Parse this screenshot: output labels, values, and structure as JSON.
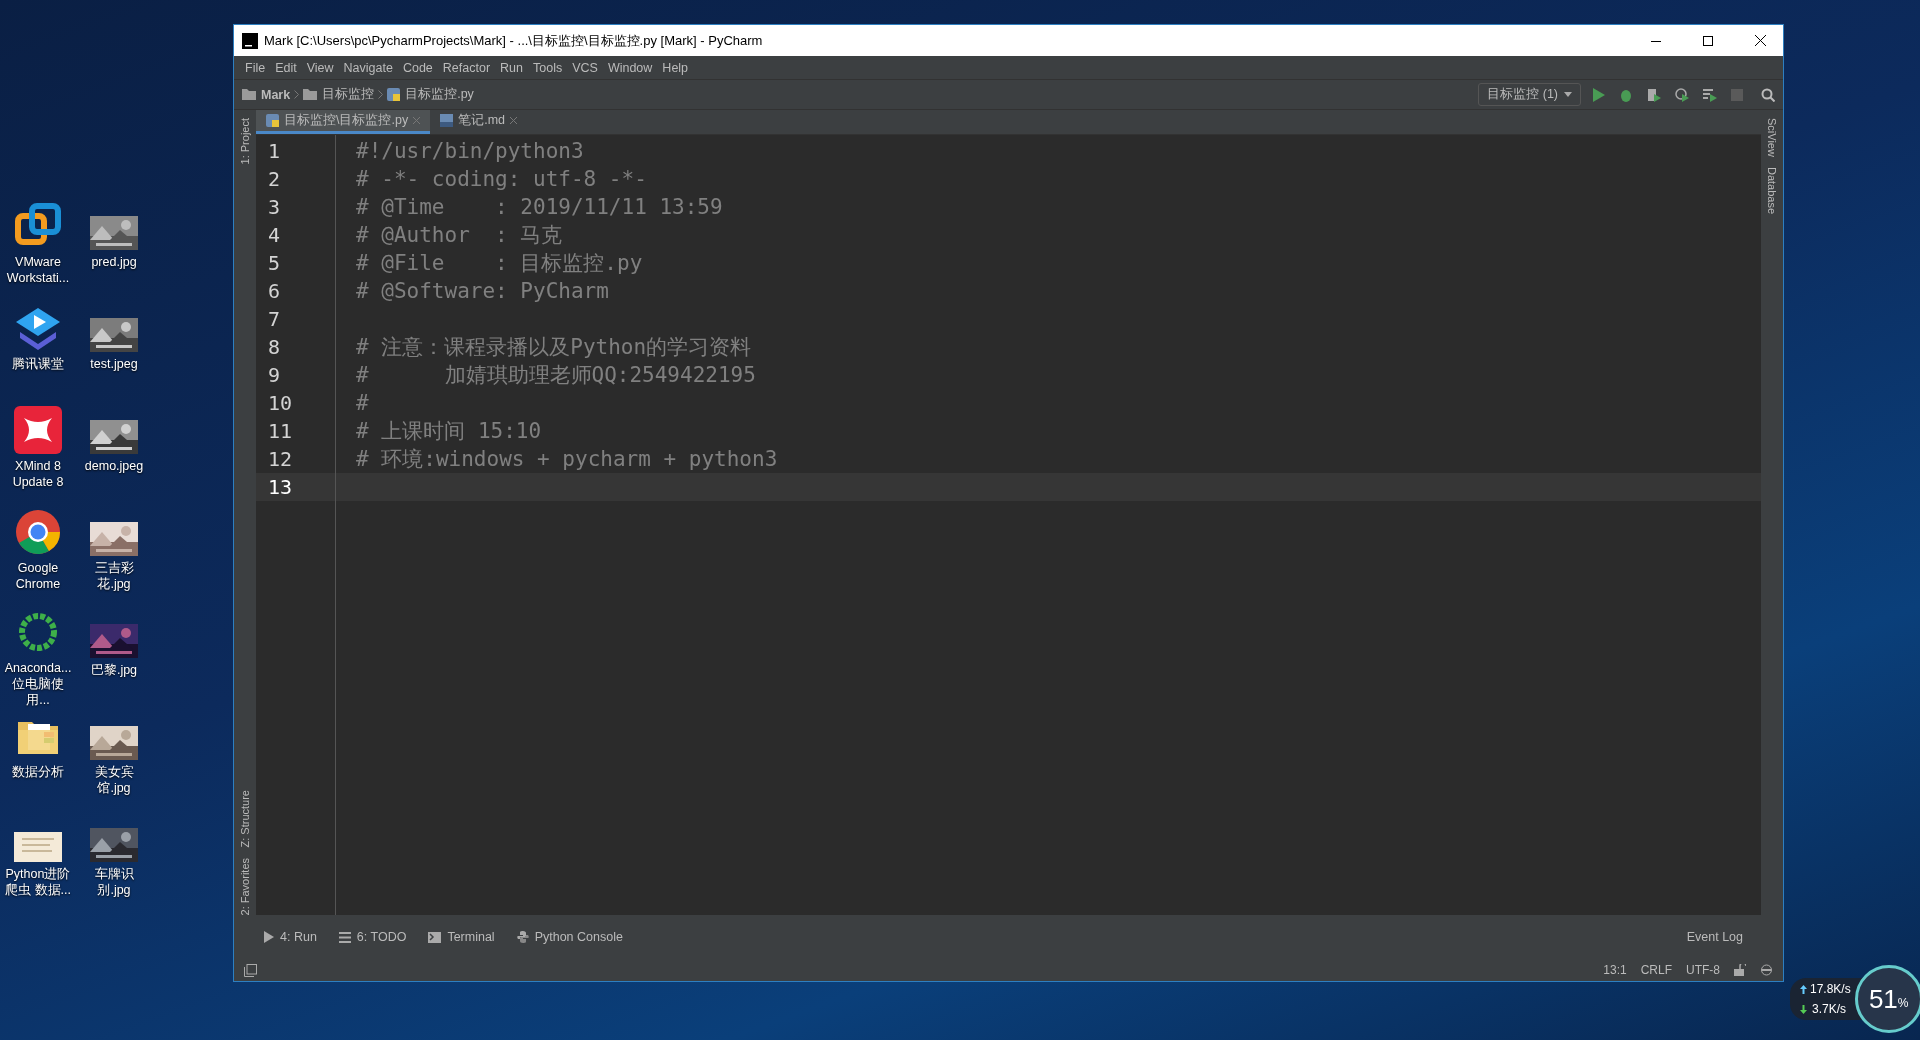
{
  "desktop": {
    "icons": [
      {
        "label": "VMware Workstati...",
        "kind": "vmware"
      },
      {
        "label": "pred.jpg",
        "kind": "picture"
      },
      {
        "label": "腾讯课堂",
        "kind": "tencent"
      },
      {
        "label": "test.jpeg",
        "kind": "picture"
      },
      {
        "label": "XMind 8 Update 8",
        "kind": "xmind"
      },
      {
        "label": "demo.jpeg",
        "kind": "picture"
      },
      {
        "label": "Google Chrome",
        "kind": "chrome"
      },
      {
        "label": "三吉彩花.jpg",
        "kind": "picture"
      },
      {
        "label": "Anaconda... 位电脑使用...",
        "kind": "anaconda"
      },
      {
        "label": "巴黎.jpg",
        "kind": "picture"
      },
      {
        "label": "数据分析",
        "kind": "folder"
      },
      {
        "label": "美女宾馆.jpg",
        "kind": "picture"
      },
      {
        "label": "Python进阶爬虫 数据...",
        "kind": "document"
      },
      {
        "label": "车牌识别.jpg",
        "kind": "picture"
      }
    ]
  },
  "window": {
    "title": "Mark [C:\\Users\\pc\\PycharmProjects\\Mark] - ...\\目标监控\\目标监控.py [Mark] - PyCharm",
    "menu": [
      "File",
      "Edit",
      "View",
      "Navigate",
      "Code",
      "Refactor",
      "Run",
      "Tools",
      "VCS",
      "Window",
      "Help"
    ],
    "breadcrumbs": [
      "Mark",
      "目标监控",
      "目标监控.py"
    ],
    "run_config": "目标监控 (1)",
    "tabs": [
      {
        "label": "目标监控\\目标监控.py",
        "selected": true
      },
      {
        "label": "笔记.md",
        "selected": false
      }
    ],
    "left_tool_tabs": [
      "1: Project",
      "Z: Structure",
      "2: Favorites"
    ],
    "right_tool_tabs": [
      "SciView",
      "Database"
    ],
    "editor": {
      "lines": [
        {
          "number": "1",
          "text": "#!/usr/bin/python3",
          "current": false
        },
        {
          "number": "2",
          "text": "# -*- coding: utf-8 -*-",
          "current": false
        },
        {
          "number": "3",
          "text": "# @Time    : 2019/11/11 13:59",
          "current": false
        },
        {
          "number": "4",
          "text": "# @Author  : 马克",
          "current": false
        },
        {
          "number": "5",
          "text": "# @File    : 目标监控.py",
          "current": false
        },
        {
          "number": "6",
          "text": "# @Software: PyCharm",
          "current": false
        },
        {
          "number": "7",
          "current": false
        },
        {
          "number": "8",
          "text": "# 注意：课程录播以及Python的学习资料",
          "current": false
        },
        {
          "number": "9",
          "text": "#      加婧琪助理老师QQ:2549422195",
          "current": false
        },
        {
          "number": "10",
          "text": "#",
          "current": false
        },
        {
          "number": "11",
          "text": "# 上课时间 15:10",
          "current": false
        },
        {
          "number": "12",
          "text": "# 环境:windows + pycharm + python3",
          "current": false
        },
        {
          "number": "13",
          "current": true
        }
      ]
    },
    "tool_windows": [
      {
        "label": "4: Run",
        "kind": "run"
      },
      {
        "label": "6: TODO",
        "kind": "todo"
      },
      {
        "label": "Terminal",
        "kind": "terminal"
      },
      {
        "label": "Python Console",
        "kind": "console"
      }
    ],
    "event_log": "Event Log",
    "status_bar": [
      "13:1",
      "CRLF",
      "UTF-8"
    ]
  },
  "net_monitor": {
    "upload": "17.8K/s",
    "download": "3.7K/s",
    "cpu": "51",
    "cpu_unit": "%"
  }
}
